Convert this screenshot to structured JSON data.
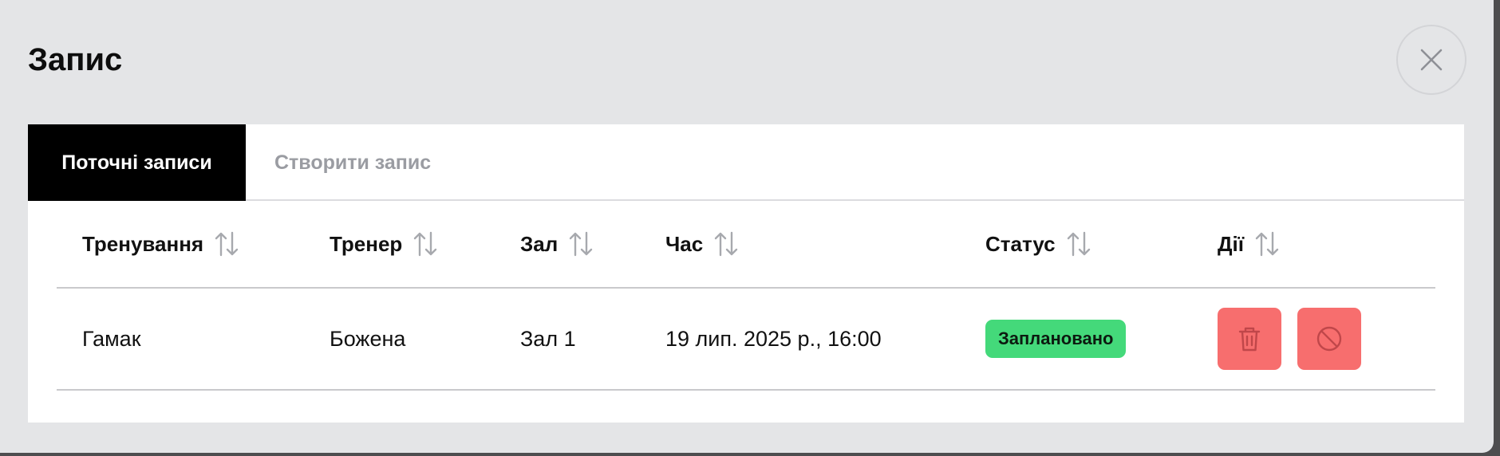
{
  "modal": {
    "title": "Запис"
  },
  "tabs": [
    {
      "label": "Поточні записи",
      "active": true
    },
    {
      "label": "Створити запис",
      "active": false
    }
  ],
  "table": {
    "columns": [
      "Тренування",
      "Тренер",
      "Зал",
      "Час",
      "Статус",
      "Дії"
    ],
    "rows": [
      {
        "training": "Гамак",
        "trainer": "Божена",
        "hall": "Зал 1",
        "time": "19 лип. 2025 р., 16:00",
        "status": "Заплановано",
        "actions": [
          "trash-icon",
          "cancel-icon"
        ]
      }
    ]
  },
  "colors": {
    "background": "#e4e5e7",
    "active_tab": "#000000",
    "status_badge": "#44d97a",
    "action_button": "#f76e6e"
  }
}
